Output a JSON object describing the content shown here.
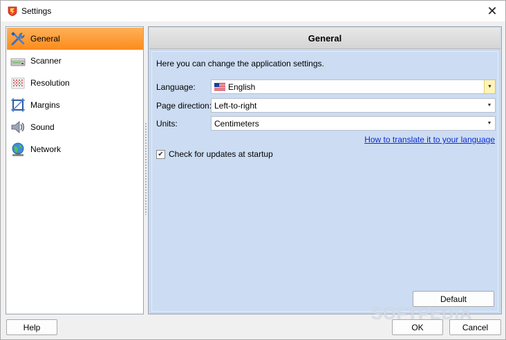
{
  "window": {
    "title": "Settings",
    "close_glyph": "✕"
  },
  "sidebar": {
    "items": [
      {
        "label": "General",
        "icon": "tools-icon",
        "active": true
      },
      {
        "label": "Scanner",
        "icon": "scanner-icon",
        "active": false
      },
      {
        "label": "Resolution",
        "icon": "resolution-icon",
        "active": false
      },
      {
        "label": "Margins",
        "icon": "margins-icon",
        "active": false
      },
      {
        "label": "Sound",
        "icon": "speaker-icon",
        "active": false
      },
      {
        "label": "Network",
        "icon": "globe-icon",
        "active": false
      }
    ]
  },
  "panel": {
    "title": "General",
    "intro": "Here you can change the application settings.",
    "language": {
      "label": "Language:",
      "value": "English",
      "icon": "us-flag-icon"
    },
    "page_direction": {
      "label": "Page direction:",
      "value": "Left-to-right"
    },
    "units": {
      "label": "Units:",
      "value": "Centimeters"
    },
    "translate_link": "How to translate it to your language",
    "check_updates": {
      "label": "Check for updates at startup",
      "checked": true,
      "glyph": "✔"
    },
    "default_button": "Default"
  },
  "footer": {
    "help": "Help",
    "ok": "OK",
    "cancel": "Cancel"
  },
  "watermark": "SOFTPEDIA",
  "colors": {
    "accent": "#fb8b1b",
    "panel_bg": "#ccdcf2",
    "link": "#0a2ad8"
  }
}
